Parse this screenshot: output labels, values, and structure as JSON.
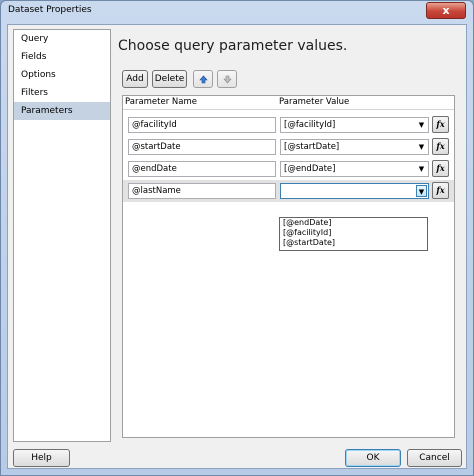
{
  "window": {
    "title": "Dataset Properties",
    "close_label": "x"
  },
  "sidebar": {
    "items": [
      {
        "label": "Query"
      },
      {
        "label": "Fields"
      },
      {
        "label": "Options"
      },
      {
        "label": "Filters"
      },
      {
        "label": "Parameters",
        "selected": true
      }
    ]
  },
  "main": {
    "heading": "Choose query parameter values.",
    "toolbar": {
      "add_label": "Add",
      "delete_label": "Delete"
    },
    "grid": {
      "col_name": "Parameter Name",
      "col_value": "Parameter Value",
      "rows": [
        {
          "name": "@facilityId",
          "value": "[@facilityId]"
        },
        {
          "name": "@startDate",
          "value": "[@startDate]"
        },
        {
          "name": "@endDate",
          "value": "[@endDate]"
        },
        {
          "name": "@lastName",
          "value": ""
        }
      ],
      "fx_label": "fx"
    },
    "dropdown_options": [
      "[@endDate]",
      "[@facilityId]",
      "[@startDate]"
    ]
  },
  "footer": {
    "help_label": "Help",
    "ok_label": "OK",
    "cancel_label": "Cancel"
  },
  "colors": {
    "selected_nav": "#c4d2e2",
    "title_bar": "#c9d9ee",
    "close_button": "#c7463a"
  }
}
